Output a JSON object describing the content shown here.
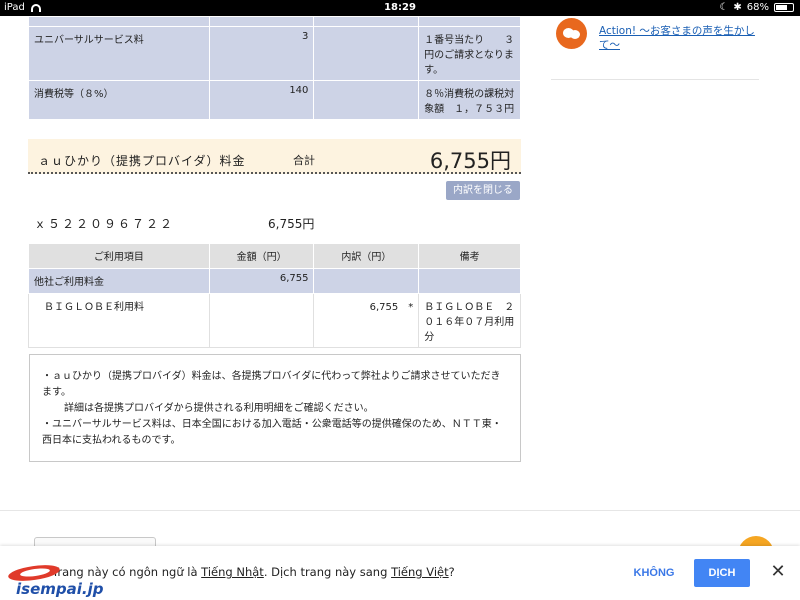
{
  "status_bar": {
    "device": "iPad",
    "time": "18:29",
    "battery": "68%",
    "battery_level": 0.68
  },
  "top_rows": [
    {
      "item": "ユニバーサルサービス料",
      "amount": "3",
      "breakdown": "",
      "note": "１番号当たり　　３円のご請求となります。"
    },
    {
      "item": "消費税等（８%）",
      "amount": "140",
      "breakdown": "",
      "note": "８％消費税の課税対象額　１，７５３円"
    }
  ],
  "total": {
    "label": "ａｕひかり（提携プロバイダ）料金",
    "sum_label": "合計",
    "amount": "6,755円"
  },
  "close_button": "内訳を閉じる",
  "account": {
    "id": "ｘ５２２０９６７２２",
    "amount": "6,755円"
  },
  "detail_table": {
    "headers": [
      "ご利用項目",
      "金額（円）",
      "内訳（円）",
      "備考"
    ],
    "rows": [
      {
        "item": "他社ご利用料金",
        "amount": "6,755",
        "breakdown": "",
        "note": ""
      },
      {
        "item": "　ＢＩＧＬＯＢＥ利用料",
        "amount": "",
        "breakdown": "6,755　*",
        "note": "ＢＩＧＬＯＢＥ　２０１６年０７月利用分"
      }
    ]
  },
  "notes": [
    "・ａｕひかり（提携プロバイダ）料金は、各提携プロバイダに代わって弊社よりご請求させていただきます。",
    "詳細は各提携プロバイダから提供される利用明細をご確認ください。",
    "・ユニバーサルサービス料は、日本全国における加入電話・公衆電話等の提供確保のため、ＮＴＴ東・西日本に支払われるものです。"
  ],
  "sidebar": {
    "link": "Action! ～お客さまの声を生かして～",
    "icon": "chat-bubbles-icon",
    "accent": "#e8681e"
  },
  "translate_bar": {
    "msg_prefix": "Trang này có ngôn ngữ là ",
    "source_lang": "Tiếng Nhật",
    "msg_middle": ". Dịch trang này sang ",
    "target_lang": "Tiếng Việt",
    "msg_suffix": "?",
    "no_label": "KHÔNG",
    "yes_label": "DỊCH",
    "close": "✕",
    "accent": "#4285f4"
  },
  "watermark": {
    "text": "isempai.jp"
  }
}
